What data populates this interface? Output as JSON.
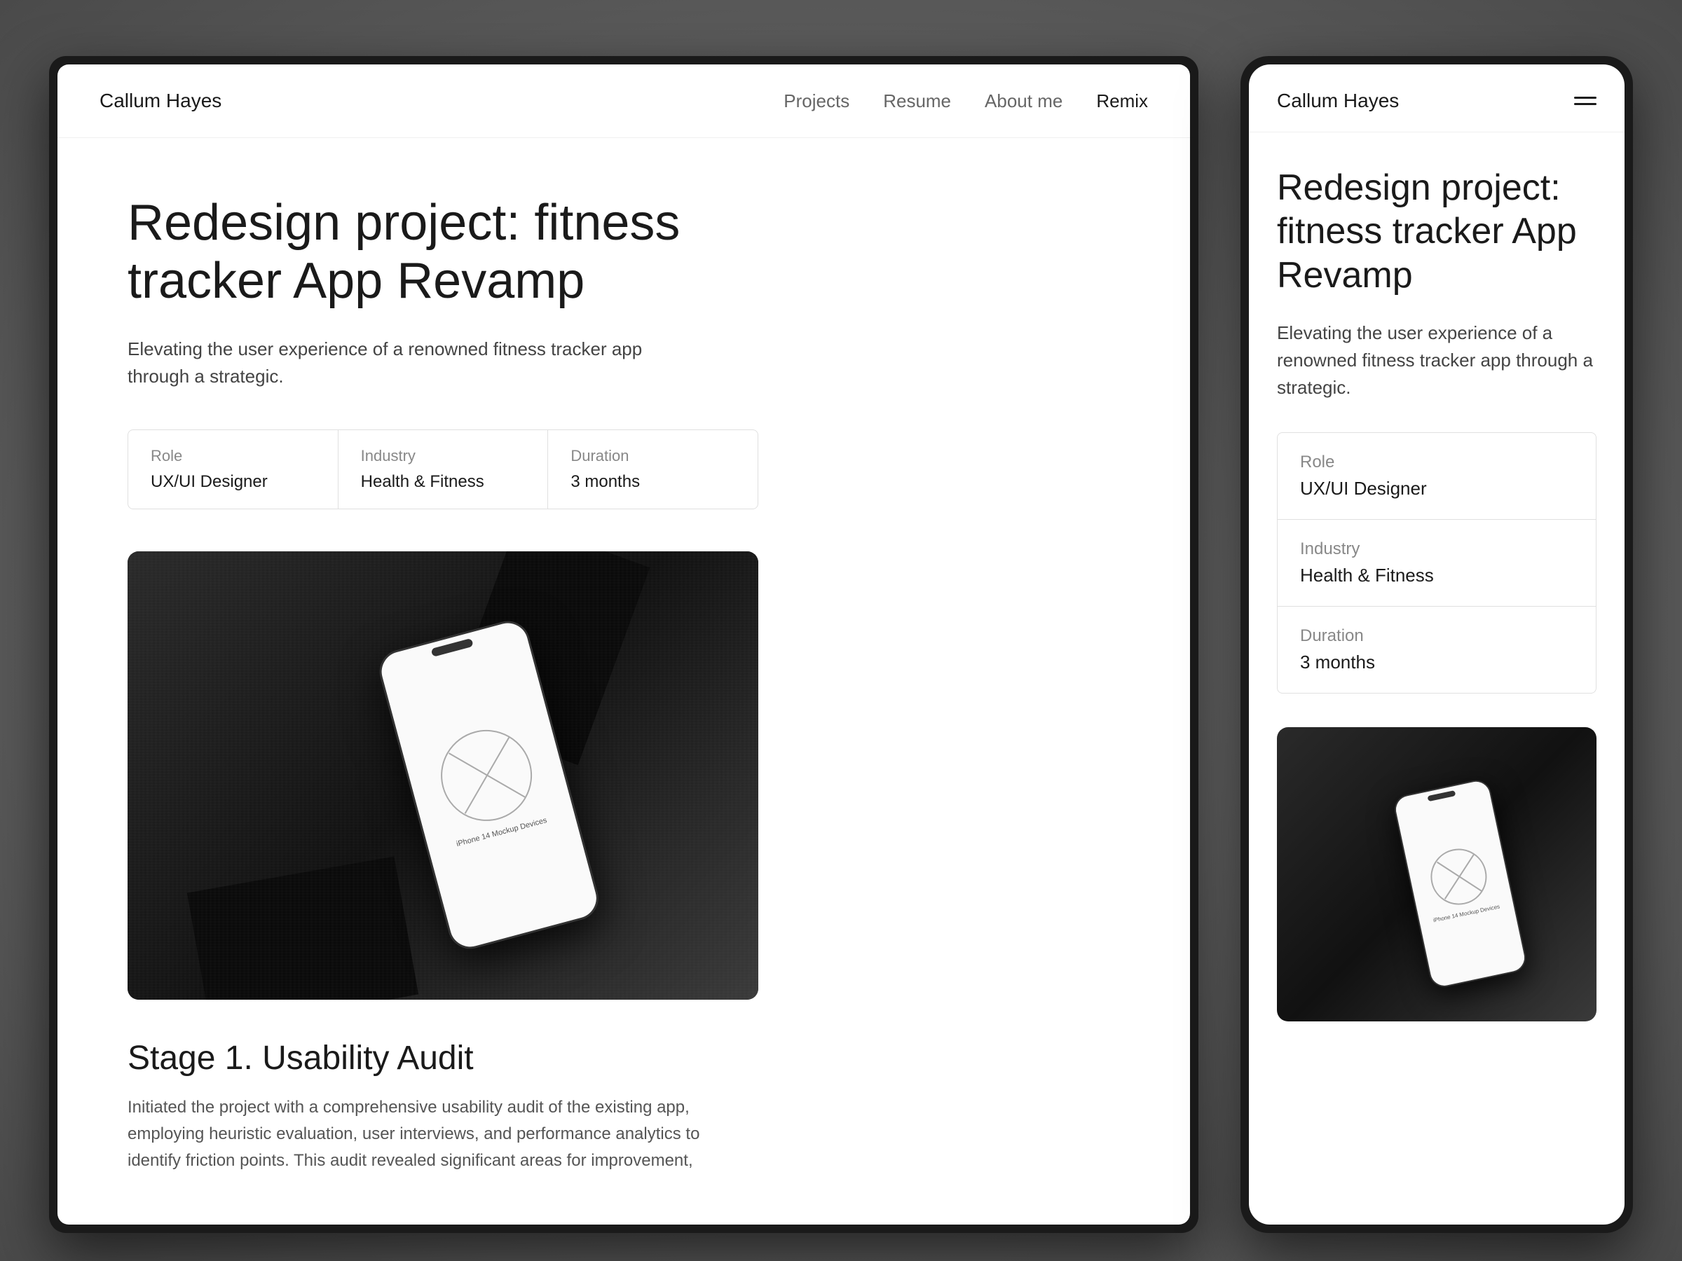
{
  "site": {
    "logo": "Callum Hayes",
    "nav": {
      "links": [
        {
          "label": "Projects",
          "active": false
        },
        {
          "label": "Resume",
          "active": false
        },
        {
          "label": "About me",
          "active": false
        },
        {
          "label": "Remix",
          "active": true
        }
      ]
    }
  },
  "desktop": {
    "title": "Redesign project: fitness tracker App Revamp",
    "subtitle": "Elevating the user experience of a renowned fitness tracker app through a strategic.",
    "meta": {
      "role_label": "Role",
      "role_value": "UX/UI Designer",
      "industry_label": "Industry",
      "industry_value": "Health & Fitness",
      "duration_label": "Duration",
      "duration_value": "3 months"
    },
    "stage1": {
      "title": "Stage 1. Usability Audit",
      "text": "Initiated the project with a comprehensive usability audit of the existing app, employing heuristic evaluation, user interviews, and performance analytics to identify friction points. This audit revealed significant areas for improvement,"
    },
    "phone_mockup_text": "iPhone 14 Mockup Devices"
  },
  "mobile": {
    "logo": "Callum Hayes",
    "title": "Redesign project: fitness tracker App Revamp",
    "subtitle": "Elevating the user experience of a renowned fitness tracker app through a strategic.",
    "meta": {
      "role_label": "Role",
      "role_value": "UX/UI Designer",
      "industry_label": "Industry",
      "industry_value": "Health & Fitness",
      "duration_label": "Duration",
      "duration_value": "3 months"
    },
    "phone_mockup_text": "iPhone 14 Mockup Devices"
  }
}
